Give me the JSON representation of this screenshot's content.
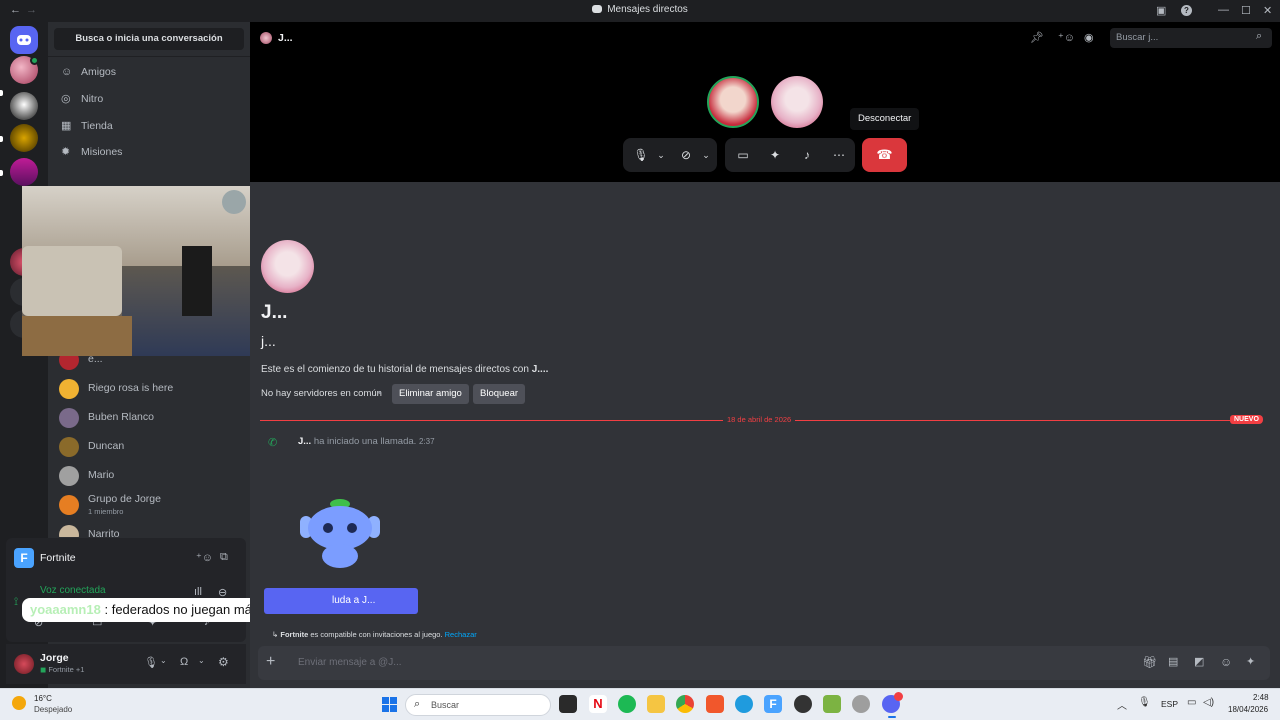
{
  "window": {
    "title": "Mensajes directos"
  },
  "sidebar": {
    "search_label": "Busca o inicia una conversación",
    "nav": [
      {
        "label": "Amigos"
      },
      {
        "label": "Nitro"
      },
      {
        "label": "Tienda"
      },
      {
        "label": "Misiones"
      }
    ],
    "dms": [
      {
        "name": "e..."
      },
      {
        "name": "Riego rosa is here"
      },
      {
        "name": "Buben Rlanco"
      },
      {
        "name": "Duncan"
      },
      {
        "name": "Mario"
      },
      {
        "name": "Grupo de Jorge",
        "sub": "1 miembro"
      },
      {
        "name": "Narrito"
      }
    ]
  },
  "voice": {
    "game": "Fortnite",
    "status": "Voz conectada"
  },
  "overlay_message": {
    "author": "yoaaamn18",
    "sep": ":",
    "text": "federados no juegan más no?"
  },
  "user": {
    "name": "Jorge",
    "activity": "Fortnite +1"
  },
  "header": {
    "channel": "J...",
    "search_placeholder": "Buscar j..."
  },
  "call": {
    "tooltip": "Desconectar"
  },
  "chat": {
    "display_name": "J...",
    "username": "j...",
    "intro": "Este es el comienzo de tu historial de mensajes directos con ",
    "intro_name": "J....",
    "no_servers": "No hay servidores en común",
    "remove_friend": "Eliminar amigo",
    "block": "Bloquear",
    "date": "18 de abril de 2026",
    "new_badge": "NUEVO",
    "call_author": "J...",
    "call_text": " ha iniciado una llamada.",
    "call_time": "2:37",
    "wave_button": "luda a J...",
    "invite_game": "Fortnite",
    "invite_text": " es compatible con invitaciones al juego. ",
    "invite_reject": "Rechazar",
    "input_placeholder": "Enviar mensaje a @J..."
  },
  "taskbar": {
    "weather_temp": "16°C",
    "weather_desc": "Despejado",
    "search_placeholder": "Buscar",
    "lang": "ESP",
    "time": "2:48",
    "date": "18/04/2026"
  },
  "colors": {
    "accent": "#5865f2",
    "danger": "#da373c",
    "new_badge": "#f23f43",
    "online": "#23a55a",
    "link": "#00a8fc"
  }
}
